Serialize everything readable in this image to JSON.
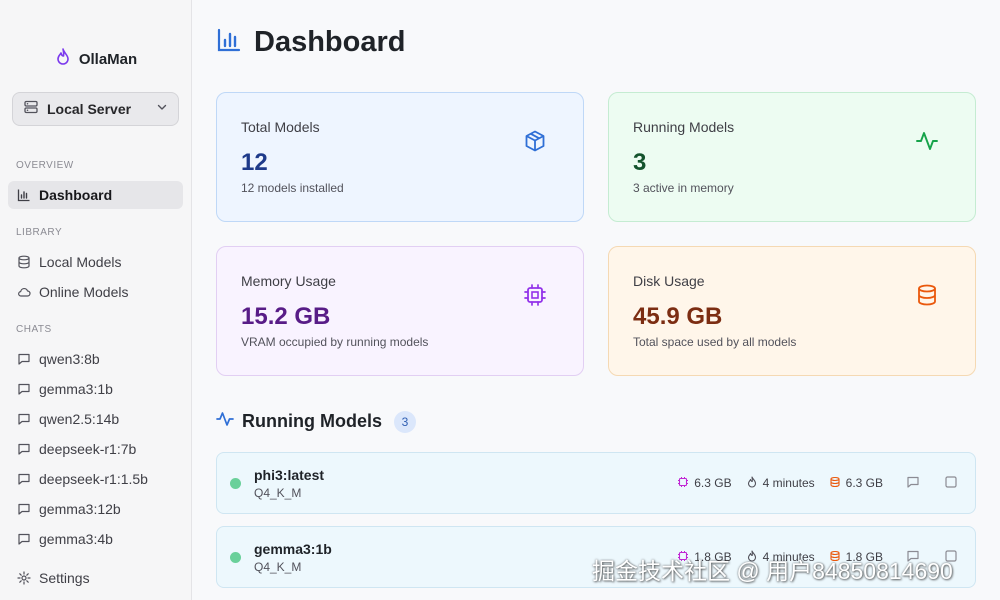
{
  "app": {
    "name": "OllaMan"
  },
  "server_select": {
    "selected": "Local Server"
  },
  "sections": {
    "overview": "OVERVIEW",
    "library": "LIBRARY",
    "chats": "CHATS"
  },
  "nav": {
    "dashboard": "Dashboard",
    "local_models": "Local Models",
    "online_models": "Online Models",
    "settings": "Settings"
  },
  "chats": [
    "qwen3:8b",
    "gemma3:1b",
    "qwen2.5:14b",
    "deepseek-r1:7b",
    "deepseek-r1:1.5b",
    "gemma3:12b",
    "gemma3:4b"
  ],
  "page": {
    "title": "Dashboard"
  },
  "cards": {
    "total": {
      "title": "Total Models",
      "value": "12",
      "sub": "12 models installed"
    },
    "running": {
      "title": "Running Models",
      "value": "3",
      "sub": "3 active in memory"
    },
    "memory": {
      "title": "Memory Usage",
      "value": "15.2 GB",
      "sub": "VRAM occupied by running models"
    },
    "disk": {
      "title": "Disk Usage",
      "value": "45.9 GB",
      "sub": "Total space used by all models"
    }
  },
  "running_models": {
    "title": "Running Models",
    "count": "3",
    "items": [
      {
        "name": "phi3:latest",
        "quant": "Q4_K_M",
        "vram": "6.3 GB",
        "time": "4 minutes",
        "size": "6.3 GB"
      },
      {
        "name": "gemma3:1b",
        "quant": "Q4_K_M",
        "vram": "1.8 GB",
        "time": "4 minutes",
        "size": "1.8 GB"
      }
    ]
  },
  "watermark": "掘金技术社区 @ 用户84850814690",
  "colors": {
    "accent": "#2f6fd6",
    "total_value": "#1e3a8a",
    "running_value": "#14532d",
    "memory_value": "#581c87",
    "disk_value": "#7c2d12",
    "status_running": "#6ad09a"
  }
}
